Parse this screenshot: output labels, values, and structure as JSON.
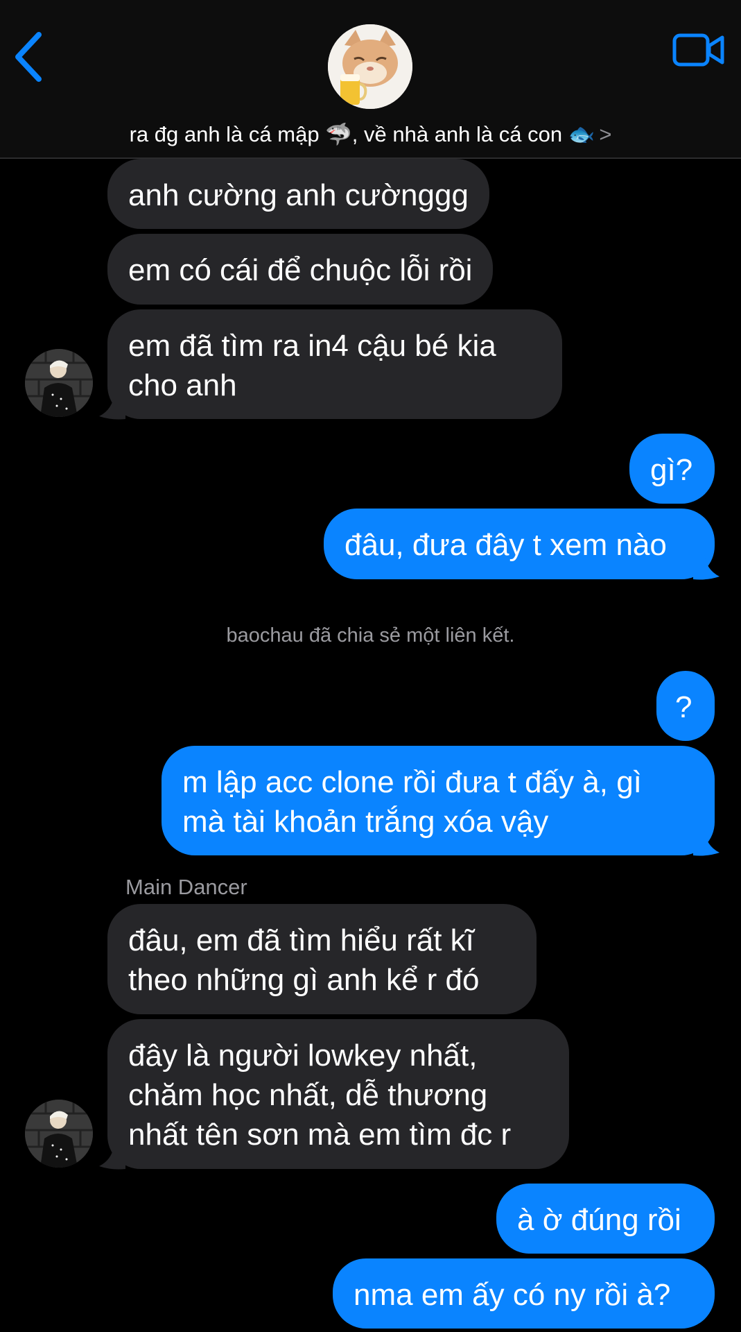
{
  "header": {
    "title": "ra đg anh là cá mập 🦈, về nhà anh là cá con 🐟",
    "chevron": ">",
    "back_icon": "chevron-left-icon",
    "video_icon": "video-camera-icon",
    "accent_color": "#0a84ff"
  },
  "messages": [
    {
      "direction": "in",
      "text": "anh cường anh cườnggg"
    },
    {
      "direction": "in",
      "text": "em có cái để chuộc lỗi rồi"
    },
    {
      "direction": "in",
      "line1": "em đã tìm ra in4 cậu bé kia",
      "line2": "cho anh"
    },
    {
      "direction": "out",
      "text": "gì?"
    },
    {
      "direction": "out",
      "text": "đâu, đưa đây t xem nào"
    },
    {
      "direction": "out",
      "text": "?"
    },
    {
      "direction": "out",
      "line1": "m lập acc clone rồi đưa t đấy à, gì",
      "line2": "mà tài khoản trắng xóa vậy"
    },
    {
      "direction": "in",
      "line1": "đâu, em đã tìm hiểu rất kĩ",
      "line2": "theo những gì anh kể r đó"
    },
    {
      "direction": "in",
      "line1": "đây là người lowkey nhất,",
      "line2": "chăm học nhất, dễ thương",
      "line3": "nhất tên sơn mà em tìm đc r"
    },
    {
      "direction": "out",
      "text": "à ờ đúng rồi"
    },
    {
      "direction": "out",
      "text": "nma em ấy có ny rồi à?"
    }
  ],
  "system_note": "baochau đã chia sẻ một liên kết.",
  "sender_name": "Main Dancer",
  "colors": {
    "incoming_bubble": "#262629",
    "outgoing_bubble": "#0a84ff",
    "background": "#000000"
  }
}
